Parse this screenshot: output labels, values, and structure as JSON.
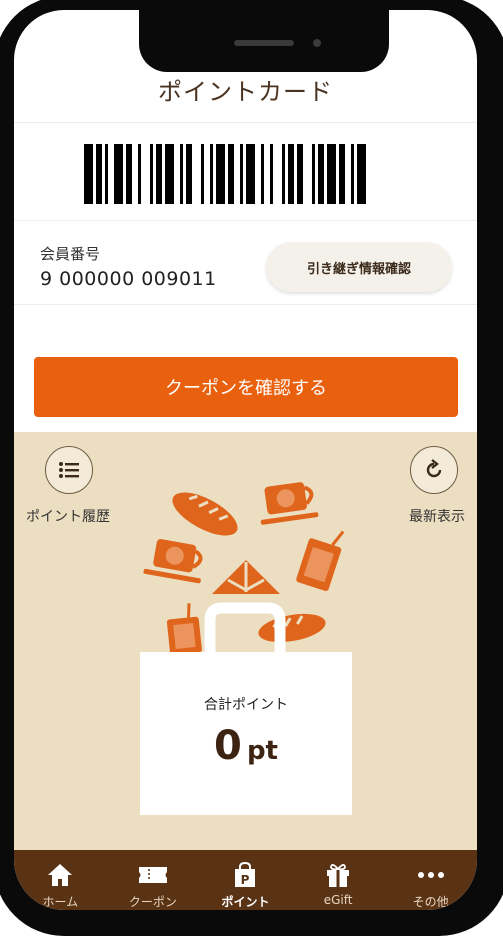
{
  "header": {
    "title": "ポイントカード"
  },
  "member": {
    "label": "会員番号",
    "number": "9 000000 009011",
    "handover_button": "引き継ぎ情報確認"
  },
  "coupon_button": "クーポンを確認する",
  "actions": {
    "history_label": "ポイント履歴",
    "refresh_label": "最新表示"
  },
  "points": {
    "label": "合計ポイント",
    "value": "0",
    "unit": "pt"
  },
  "tabs": [
    {
      "label": "ホーム",
      "icon": "home-icon"
    },
    {
      "label": "クーポン",
      "icon": "coupon-icon"
    },
    {
      "label": "ポイント",
      "icon": "point-icon",
      "active": true
    },
    {
      "label": "eGift",
      "icon": "gift-icon"
    },
    {
      "label": "その他",
      "icon": "more-icon"
    }
  ],
  "colors": {
    "accent": "#e9600f",
    "tan_background": "#ebdec1",
    "tabbar": "#5a3315",
    "illustration": "#e0651c"
  }
}
